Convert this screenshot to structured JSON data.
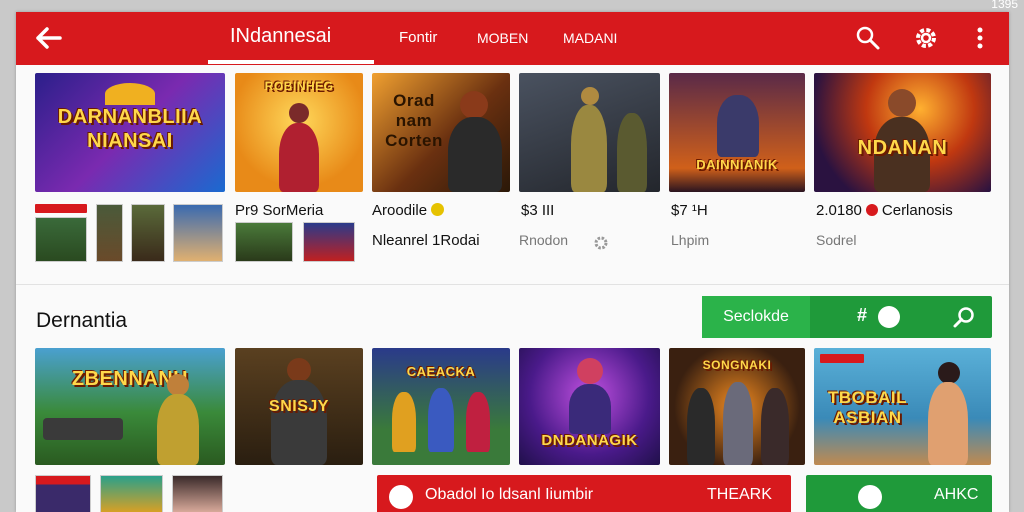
{
  "status_bar": {
    "time": "1395"
  },
  "app_bar": {
    "tabs": [
      "INdannesai",
      "Fontir",
      "MOBEN",
      "MADANI"
    ],
    "active_tab": 0
  },
  "top_row": {
    "tiles": [
      {
        "title": "DARNANBLIIA NIANSAI",
        "bg": "#3a2a9a",
        "accent": "#d8317a"
      },
      {
        "title": "ROBINHEG",
        "bg": "#f1a624",
        "accent": "#c0281e"
      },
      {
        "title": "Orad nam Corten",
        "bg": "#5a3210",
        "accent": "#f2a020"
      },
      {
        "title": "",
        "bg": "#3c3f46",
        "accent": "#8a7a3c"
      },
      {
        "title": "DAINNIANIK",
        "bg": "#4a1e3c",
        "accent": "#f07024"
      },
      {
        "title": "NDANAN",
        "bg": "#3b1b58",
        "accent": "#e45a18"
      }
    ],
    "meta": [
      {
        "line1": "Pr9 SorMeria",
        "line2": ""
      },
      {
        "line1": "Aroodile",
        "line2": "Nleanrel 1Rodai"
      },
      {
        "line1": "$3  III",
        "line2": "Rnodon"
      },
      {
        "line1": "$7  ¹H",
        "line2": "Lhpim"
      },
      {
        "line1": "2.0180",
        "line1b": "Cerlanosis",
        "line2": "Sodrel"
      }
    ]
  },
  "section": {
    "title": "Dernantia",
    "search_button": {
      "label": "Seclokde",
      "hash": "#"
    }
  },
  "bottom_row": {
    "tiles": [
      {
        "title": "ZBENNANH",
        "bg": "#2d7a3a",
        "accent": "#e2b84a"
      },
      {
        "title": "SNISJY",
        "bg": "#3a2a18",
        "accent": "#d08a3a"
      },
      {
        "title": "CAEACKA",
        "bg": "#2e3a7a",
        "accent": "#2aa04a"
      },
      {
        "title": "DNDANAGIK",
        "bg": "#4a1a8a",
        "accent": "#c040d0"
      },
      {
        "title": "SONGNAKI",
        "bg": "#3a2618",
        "accent": "#e07a20"
      },
      {
        "title": "TBOBAIL ASBIAN",
        "bg": "#2a8ab8",
        "accent": "#f0b030"
      }
    ]
  },
  "actions": {
    "red_bar": {
      "text": "Obadol Io ldsanl Iiumbir",
      "right": "THEARK"
    },
    "green_bar": {
      "text": "AHKC"
    }
  }
}
